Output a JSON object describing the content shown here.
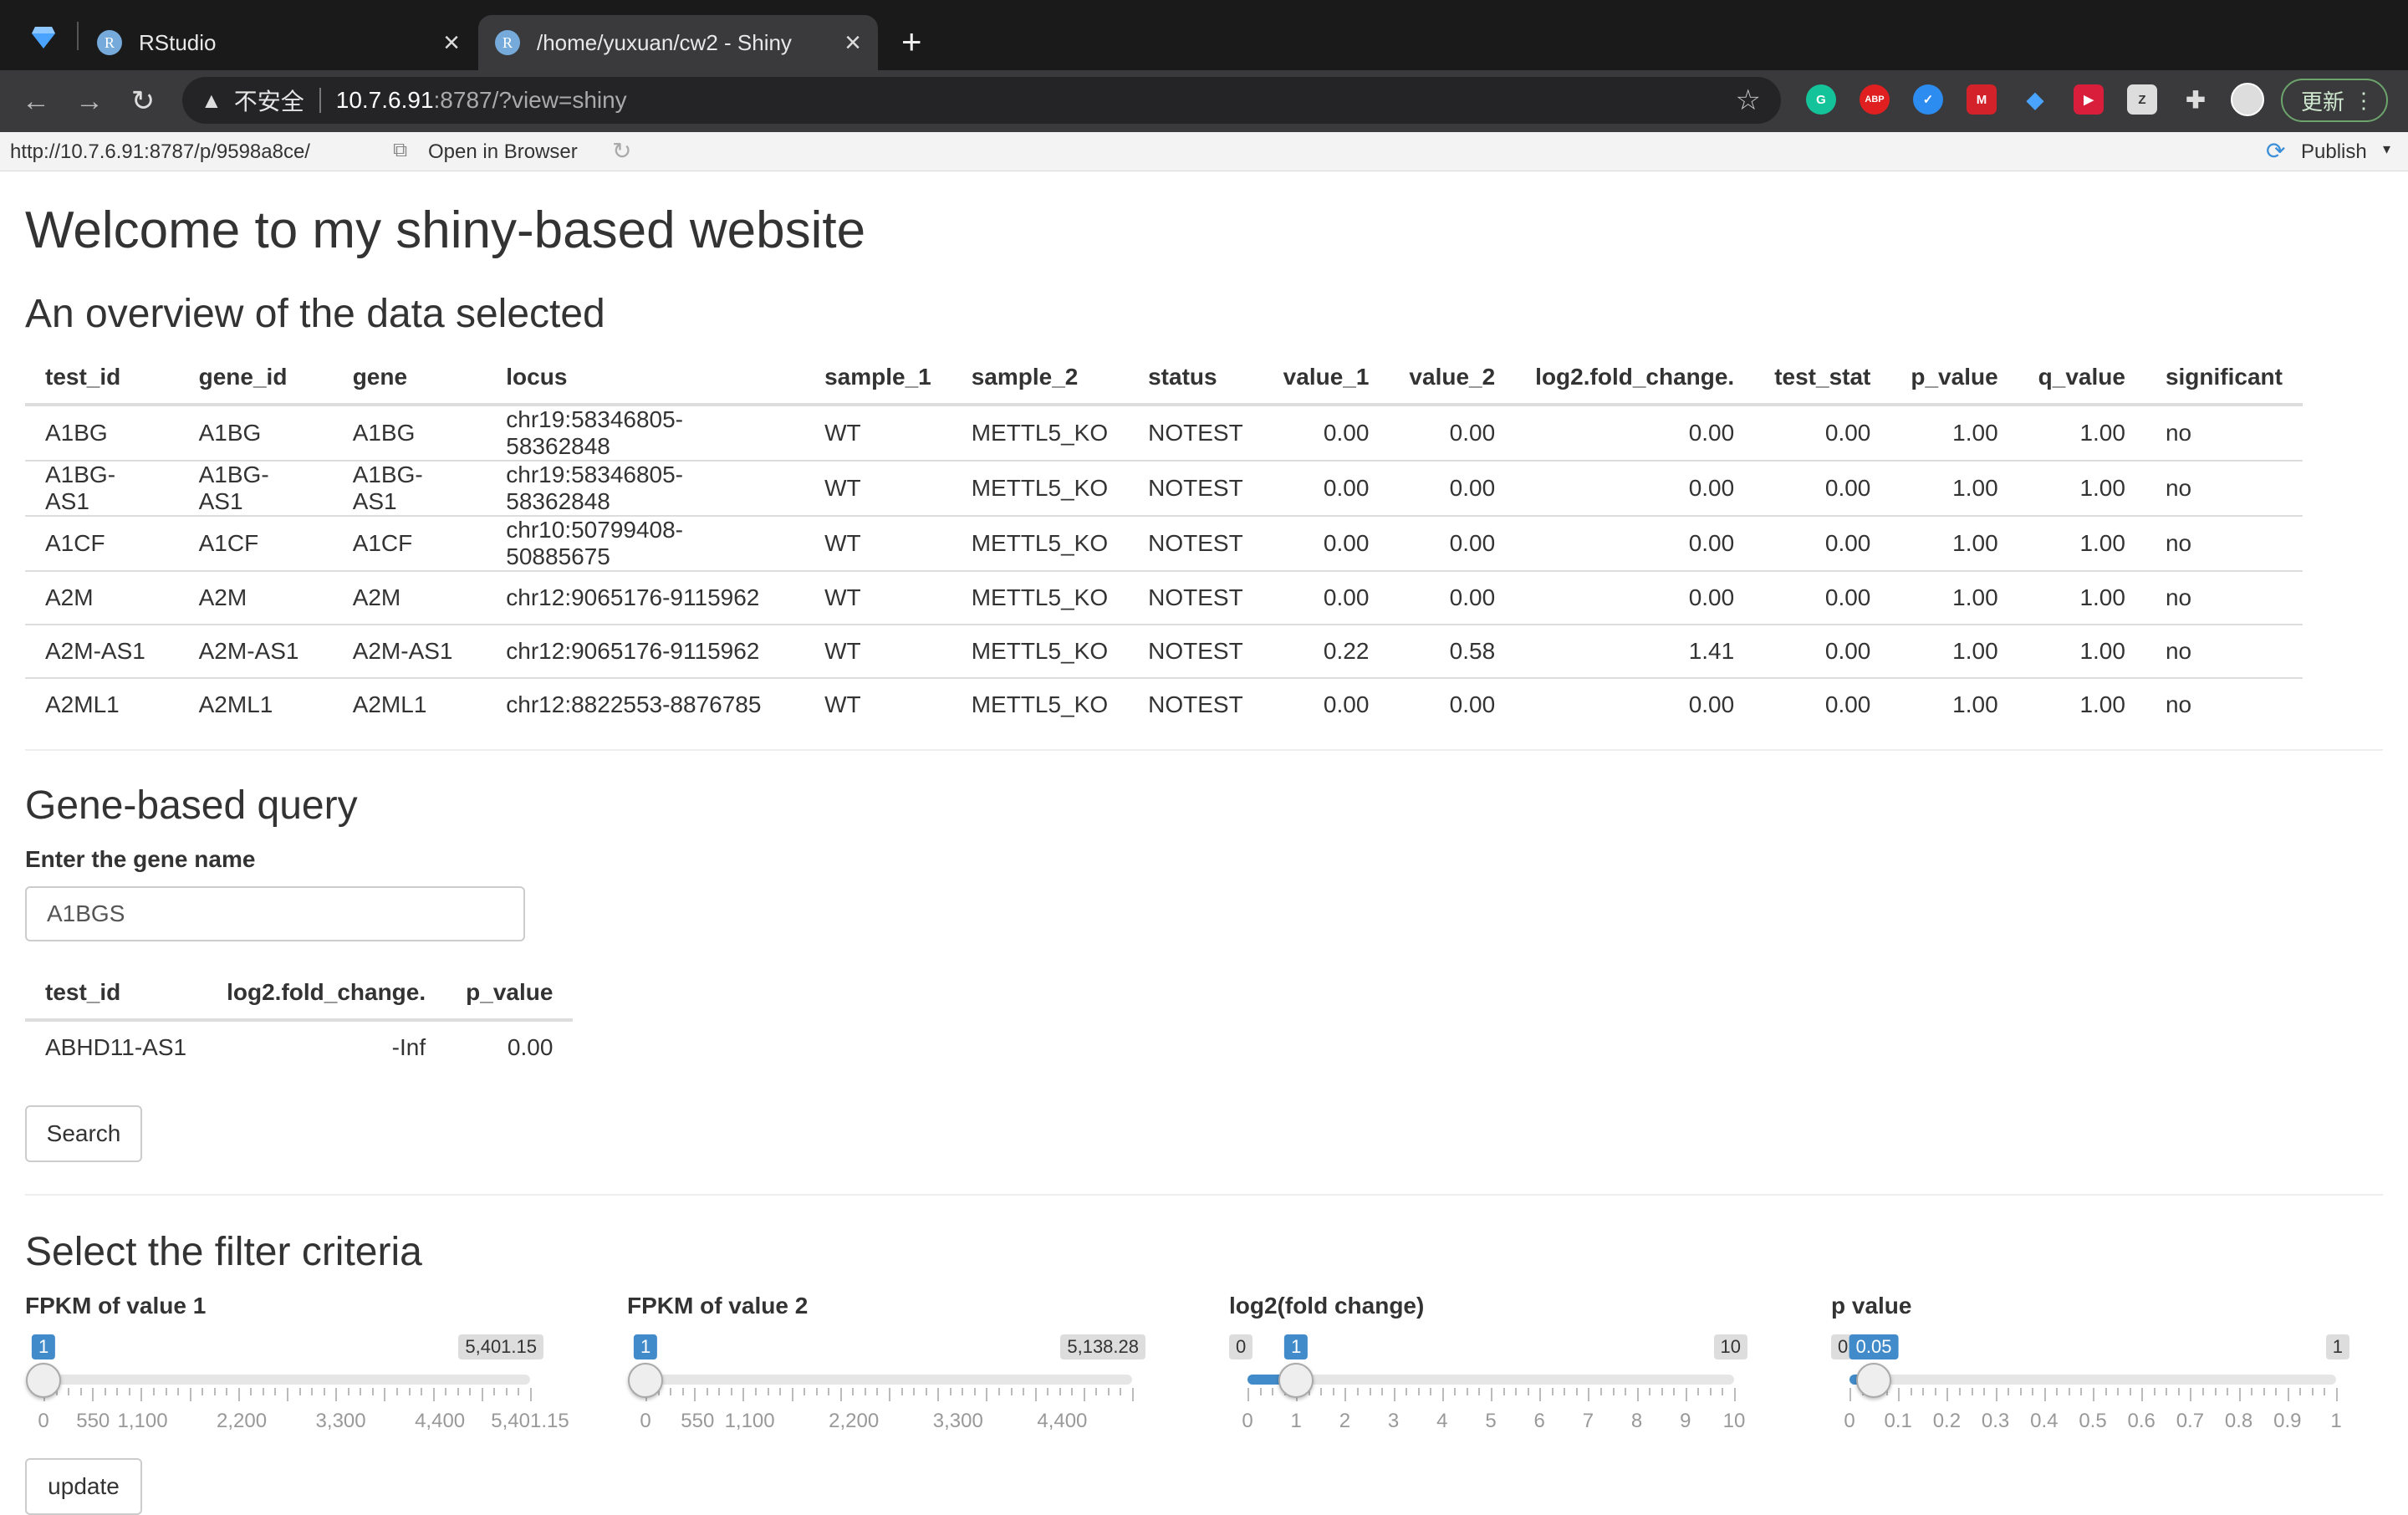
{
  "browser": {
    "tabs": [
      {
        "label": "RStudio"
      },
      {
        "label": "/home/yuxuan/cw2 - Shiny"
      }
    ],
    "security_label": "不安全",
    "url_host": "10.7.6.91",
    "url_rest": ":8787/?view=shiny",
    "update_label": "更新",
    "extensions": [
      "grammarly-icon",
      "adblock-icon",
      "extension-icon",
      "mendeley-icon",
      "gem-icon",
      "extension-red-icon",
      "extension-gray-icon",
      "puzzle-icon"
    ]
  },
  "rstudio_bar": {
    "url": "http://10.7.6.91:8787/p/9598a8ce/",
    "open_in_browser": "Open in Browser",
    "publish": "Publish"
  },
  "app": {
    "title": "Welcome to my shiny-based website",
    "overview_heading": "An overview of the data selected",
    "overview_table": {
      "columns": [
        "test_id",
        "gene_id",
        "gene",
        "locus",
        "sample_1",
        "sample_2",
        "status",
        "value_1",
        "value_2",
        "log2.fold_change.",
        "test_stat",
        "p_value",
        "q_value",
        "significant"
      ],
      "rows": [
        [
          "A1BG",
          "A1BG",
          "A1BG",
          "chr19:58346805-58362848",
          "WT",
          "METTL5_KO",
          "NOTEST",
          "0.00",
          "0.00",
          "0.00",
          "0.00",
          "1.00",
          "1.00",
          "no"
        ],
        [
          "A1BG-AS1",
          "A1BG-AS1",
          "A1BG-AS1",
          "chr19:58346805-58362848",
          "WT",
          "METTL5_KO",
          "NOTEST",
          "0.00",
          "0.00",
          "0.00",
          "0.00",
          "1.00",
          "1.00",
          "no"
        ],
        [
          "A1CF",
          "A1CF",
          "A1CF",
          "chr10:50799408-50885675",
          "WT",
          "METTL5_KO",
          "NOTEST",
          "0.00",
          "0.00",
          "0.00",
          "0.00",
          "1.00",
          "1.00",
          "no"
        ],
        [
          "A2M",
          "A2M",
          "A2M",
          "chr12:9065176-9115962",
          "WT",
          "METTL5_KO",
          "NOTEST",
          "0.00",
          "0.00",
          "0.00",
          "0.00",
          "1.00",
          "1.00",
          "no"
        ],
        [
          "A2M-AS1",
          "A2M-AS1",
          "A2M-AS1",
          "chr12:9065176-9115962",
          "WT",
          "METTL5_KO",
          "NOTEST",
          "0.22",
          "0.58",
          "1.41",
          "0.00",
          "1.00",
          "1.00",
          "no"
        ],
        [
          "A2ML1",
          "A2ML1",
          "A2ML1",
          "chr12:8822553-8876785",
          "WT",
          "METTL5_KO",
          "NOTEST",
          "0.00",
          "0.00",
          "0.00",
          "0.00",
          "1.00",
          "1.00",
          "no"
        ]
      ]
    },
    "query_heading": "Gene-based query",
    "gene_input_label": "Enter the gene name",
    "gene_input_value": "A1BGS",
    "query_table": {
      "columns": [
        "test_id",
        "log2.fold_change.",
        "p_value"
      ],
      "rows": [
        [
          "ABHD11-AS1",
          "-Inf",
          "0.00"
        ]
      ]
    },
    "search_button": "Search",
    "filter_heading": "Select the filter criteria",
    "update_button": "update",
    "sliders": [
      {
        "label": "FPKM of value 1",
        "min_label": "0",
        "max_label": "5,401.15",
        "value_label": "1",
        "min": 0,
        "max": 5401.15,
        "from": 1,
        "to": null,
        "ticks": [
          {
            "v": 0,
            "t": "0"
          },
          {
            "v": 550,
            "t": "550"
          },
          {
            "v": 1100,
            "t": "1,100"
          },
          {
            "v": 2200,
            "t": "2,200"
          },
          {
            "v": 3300,
            "t": "3,300"
          },
          {
            "v": 4400,
            "t": "4,400"
          },
          {
            "v": 5401.15,
            "t": "5,401.15"
          }
        ]
      },
      {
        "label": "FPKM of value 2",
        "min_label": "0",
        "max_label": "5,138.28",
        "value_label": "1",
        "min": 0,
        "max": 5138.28,
        "from": 1,
        "to": null,
        "ticks": [
          {
            "v": 0,
            "t": "0"
          },
          {
            "v": 550,
            "t": "550"
          },
          {
            "v": 1100,
            "t": "1,100"
          },
          {
            "v": 2200,
            "t": "2,200"
          },
          {
            "v": 3300,
            "t": "3,300"
          },
          {
            "v": 4400,
            "t": "4,400"
          }
        ]
      },
      {
        "label": "log2(fold change)",
        "min_label": "0",
        "max_label": "10",
        "value_label": "1",
        "min": 0,
        "max": 10,
        "from": 0,
        "to": 1,
        "ticks": [
          {
            "v": 0,
            "t": "0"
          },
          {
            "v": 1,
            "t": "1"
          },
          {
            "v": 2,
            "t": "2"
          },
          {
            "v": 3,
            "t": "3"
          },
          {
            "v": 4,
            "t": "4"
          },
          {
            "v": 5,
            "t": "5"
          },
          {
            "v": 6,
            "t": "6"
          },
          {
            "v": 7,
            "t": "7"
          },
          {
            "v": 8,
            "t": "8"
          },
          {
            "v": 9,
            "t": "9"
          },
          {
            "v": 10,
            "t": "10"
          }
        ]
      },
      {
        "label": "p value",
        "min_label": "0",
        "max_label": "1",
        "value_label": "0.05",
        "min": 0,
        "max": 1,
        "from": 0,
        "to": 0.05,
        "ticks": [
          {
            "v": 0,
            "t": "0"
          },
          {
            "v": 0.1,
            "t": "0.1"
          },
          {
            "v": 0.2,
            "t": "0.2"
          },
          {
            "v": 0.3,
            "t": "0.3"
          },
          {
            "v": 0.4,
            "t": "0.4"
          },
          {
            "v": 0.5,
            "t": "0.5"
          },
          {
            "v": 0.6,
            "t": "0.6"
          },
          {
            "v": 0.7,
            "t": "0.7"
          },
          {
            "v": 0.8,
            "t": "0.8"
          },
          {
            "v": 0.9,
            "t": "0.9"
          },
          {
            "v": 1,
            "t": "1"
          }
        ]
      }
    ]
  }
}
